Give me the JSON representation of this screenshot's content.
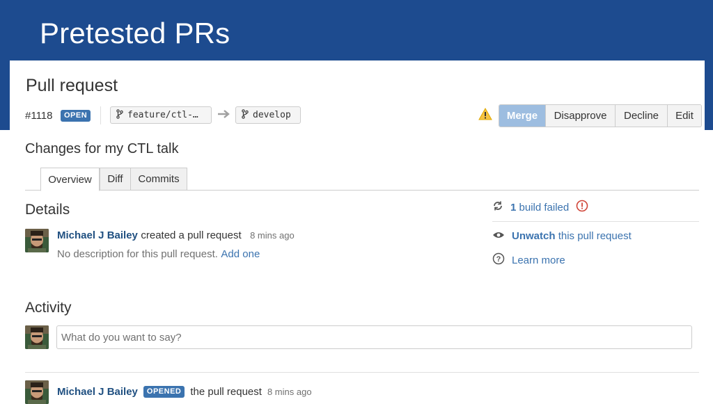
{
  "slide": {
    "title": "Pretested PRs"
  },
  "pr": {
    "heading": "Pull request",
    "number": "#1118",
    "state_badge": "OPEN",
    "source_branch": "feature/ctl-…",
    "target_branch": "develop",
    "title": "Changes for my CTL talk"
  },
  "actions": {
    "merge": "Merge",
    "disapprove": "Disapprove",
    "decline": "Decline",
    "edit": "Edit"
  },
  "tabs": [
    {
      "label": "Overview",
      "active": true
    },
    {
      "label": "Diff",
      "active": false
    },
    {
      "label": "Commits",
      "active": false
    }
  ],
  "details": {
    "heading": "Details",
    "author": "Michael J Bailey",
    "action_text": "created a pull request",
    "time": "8 mins ago",
    "no_description": "No description for this pull request.",
    "add_one": "Add one"
  },
  "sidebar": {
    "build_count": "1",
    "build_text": "build failed",
    "unwatch_link": "Unwatch",
    "unwatch_text": "this pull request",
    "learn_more": "Learn more"
  },
  "activity": {
    "heading": "Activity",
    "comment_placeholder": "What do you want to say?",
    "event_author": "Michael J Bailey",
    "event_badge": "OPENED",
    "event_text": "the pull request",
    "event_time": "8 mins ago"
  },
  "colors": {
    "banner": "#1d4b8f",
    "link": "#205081",
    "badge": "#3b73af",
    "merge_button": "#9dbde0",
    "error": "#d04437",
    "warning": "#f6c342"
  },
  "icons": [
    "branch-icon",
    "arrow-right-icon",
    "warning-icon",
    "build-refresh-icon",
    "error-icon",
    "eye-icon",
    "help-icon"
  ]
}
